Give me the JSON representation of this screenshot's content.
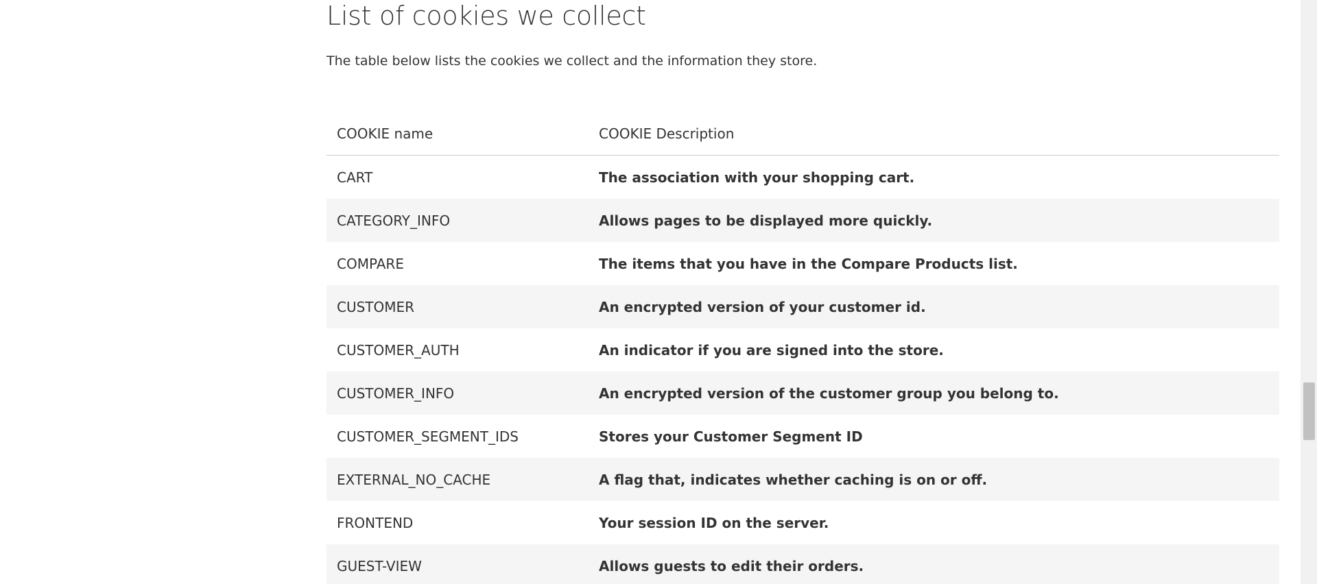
{
  "page": {
    "title": "List of cookies we collect",
    "intro": "The table below lists the cookies we collect and the information they store."
  },
  "table": {
    "headers": {
      "name": "COOKIE name",
      "description": "COOKIE Description"
    },
    "rows": [
      {
        "name": "CART",
        "description": "The association with your shopping cart."
      },
      {
        "name": "CATEGORY_INFO",
        "description": "Allows pages to be displayed more quickly."
      },
      {
        "name": "COMPARE",
        "description": "The items that you have in the Compare Products list."
      },
      {
        "name": "CUSTOMER",
        "description": "An encrypted version of your customer id."
      },
      {
        "name": "CUSTOMER_AUTH",
        "description": "An indicator if you are signed into the store."
      },
      {
        "name": "CUSTOMER_INFO",
        "description": "An encrypted version of the customer group you belong to."
      },
      {
        "name": "CUSTOMER_SEGMENT_IDS",
        "description": "Stores your Customer Segment ID"
      },
      {
        "name": "EXTERNAL_NO_CACHE",
        "description": "A flag that, indicates whether caching is on or off."
      },
      {
        "name": "FRONTEND",
        "description": "Your session ID on the server."
      },
      {
        "name": "GUEST-VIEW",
        "description": "Allows guests to edit their orders."
      }
    ]
  },
  "colors": {
    "text": "#333333",
    "row_stripe": "#f5f5f5",
    "header_border": "#cccccc",
    "scrollbar_track": "#f1f1f1",
    "scrollbar_thumb": "#c1c1c1"
  }
}
